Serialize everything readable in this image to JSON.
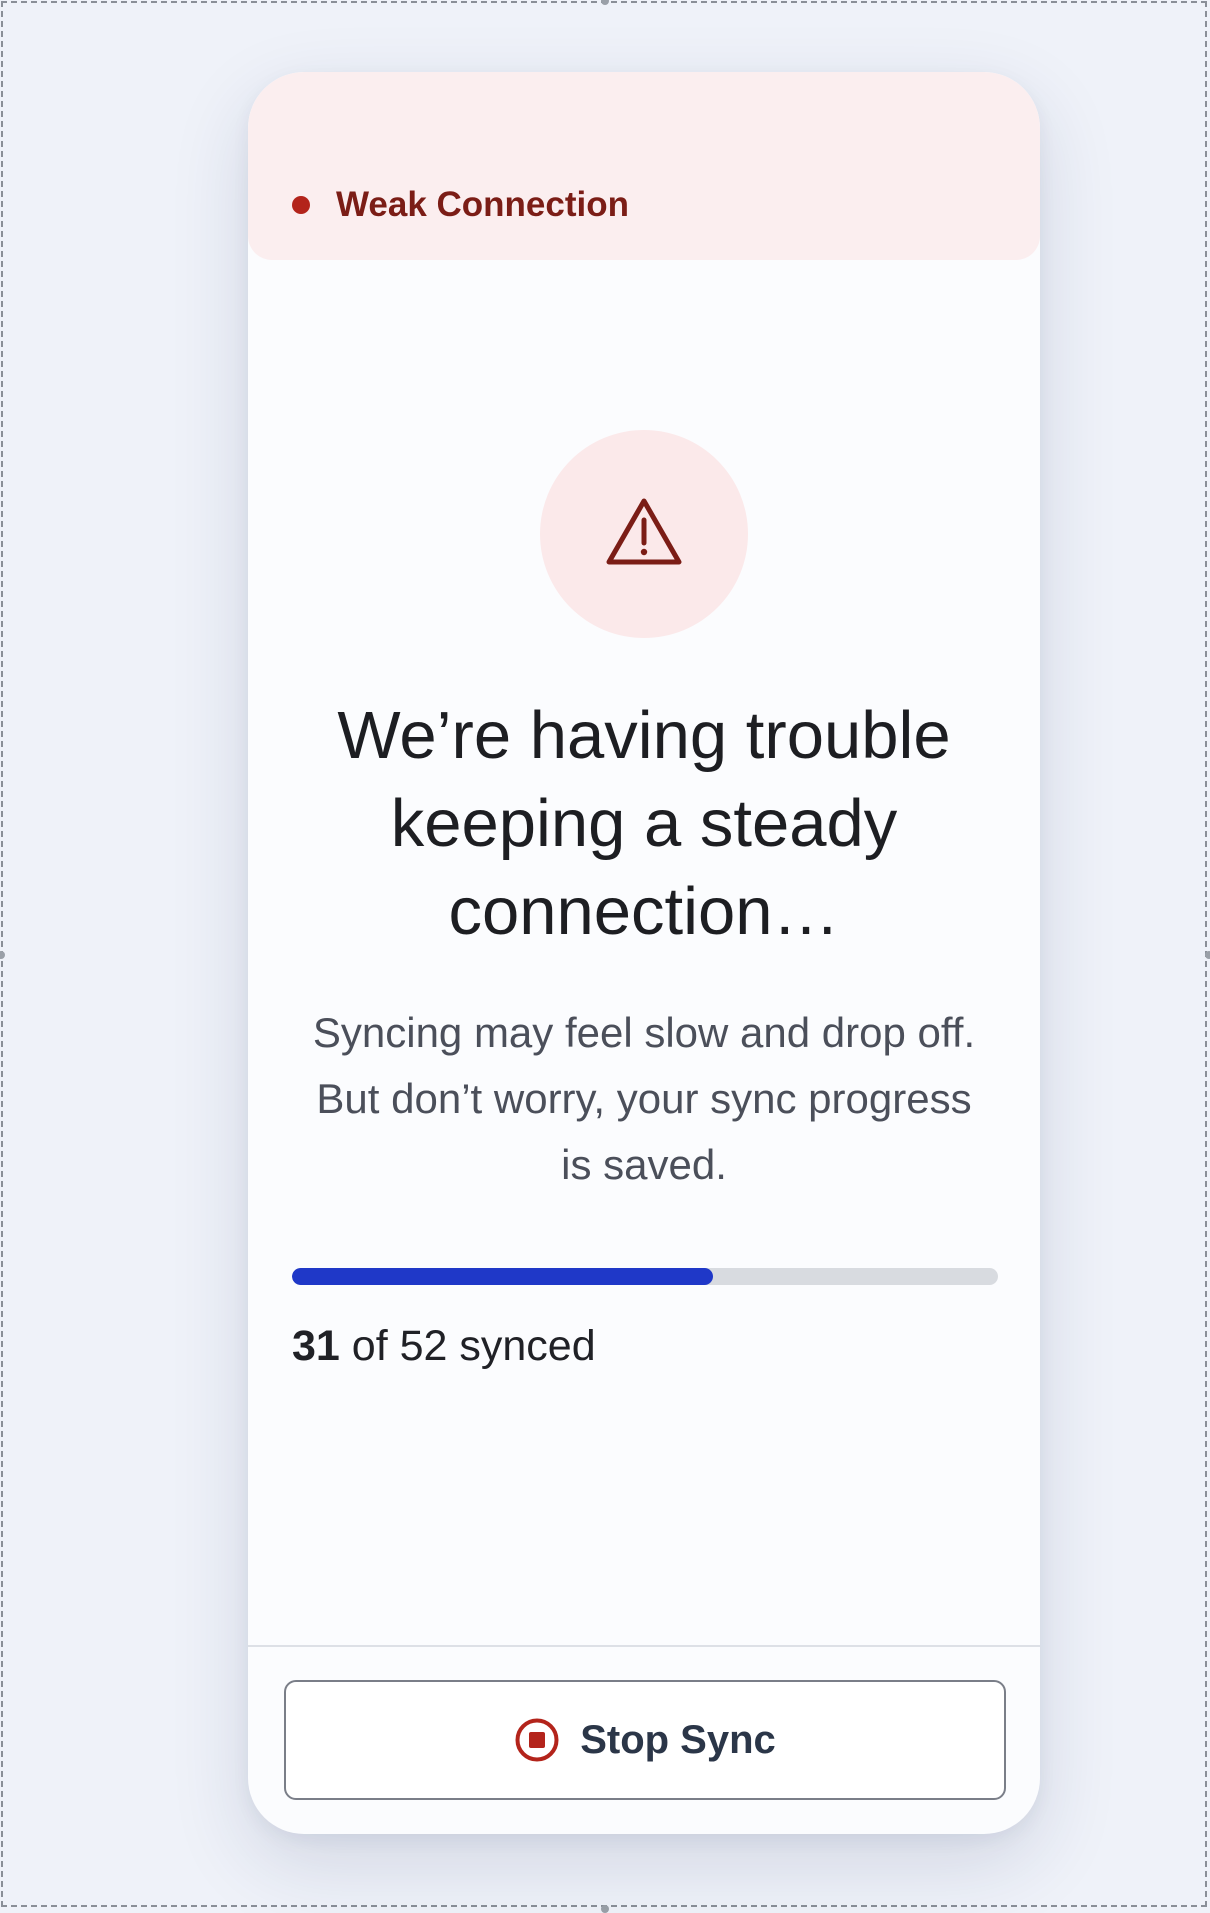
{
  "status_banner": {
    "label": "Weak Connection",
    "color": "#b3241b"
  },
  "alert": {
    "icon": "warning-triangle-icon",
    "headline": "We’re having trouble keeping a steady connection…",
    "message": "Syncing may feel slow and drop off. But don’t worry, your sync progress is saved."
  },
  "progress": {
    "synced": "31",
    "of_text": "of 52 synced",
    "total": 52,
    "fraction": 0.596,
    "fill_color": "#1f38c8"
  },
  "footer": {
    "stop_button_label": "Stop Sync",
    "stop_icon": "stop-circle-icon"
  }
}
